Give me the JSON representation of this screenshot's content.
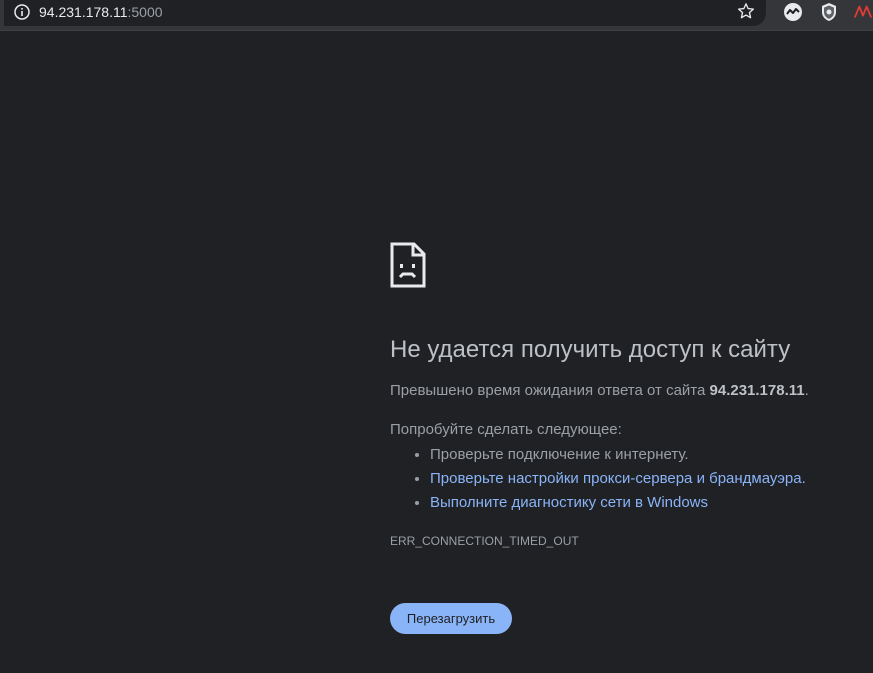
{
  "omnibox": {
    "host": "94.231.178.11",
    "port": ":5000"
  },
  "error": {
    "title": "Не удается получить доступ к сайту",
    "description_prefix": "Превышено время ожидания ответа от сайта",
    "description_host": "94.231.178.11",
    "description_suffix": ".",
    "try_heading": "Попробуйте сделать следующее:",
    "suggestions": [
      "Проверьте подключение к интернету.",
      "Проверьте настройки прокси-сервера и брандмауэра.",
      "Выполните диагностику сети в Windows"
    ],
    "code": "ERR_CONNECTION_TIMED_OUT",
    "reload_label": "Перезагрузить"
  },
  "colors": {
    "background": "#202124",
    "toolbar": "#35363a",
    "link": "#8ab4f8",
    "button": "#8ab4f8"
  },
  "icons": [
    "info-icon",
    "bookmark-star-icon",
    "extension-icon",
    "shield-extension-icon",
    "extension-red-icon",
    "sad-page-icon"
  ]
}
